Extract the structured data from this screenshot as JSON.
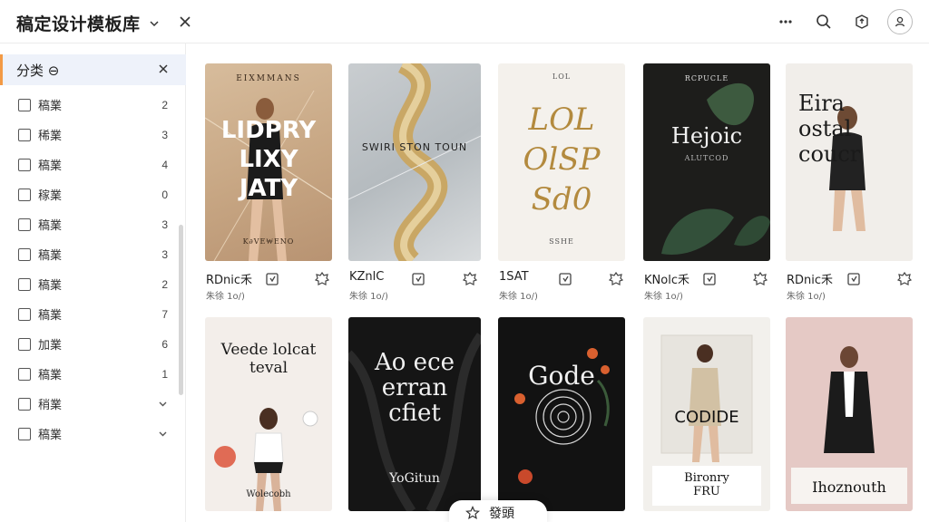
{
  "header": {
    "title": "稿定设计模板库"
  },
  "sidebar": {
    "category_title": "分类 ⊖",
    "items": [
      {
        "label": "稿業",
        "count": "2"
      },
      {
        "label": "稀業",
        "count": "3"
      },
      {
        "label": "稿業",
        "count": "4"
      },
      {
        "label": "稼業",
        "count": "0"
      },
      {
        "label": "稿業",
        "count": "3"
      },
      {
        "label": "稿業",
        "count": "3"
      },
      {
        "label": "稿業",
        "count": "2"
      },
      {
        "label": "稿業",
        "count": "7"
      },
      {
        "label": "加業",
        "count": "6"
      },
      {
        "label": "稿業",
        "count": "1"
      },
      {
        "label": "稍業",
        "count": ""
      },
      {
        "label": "稿業",
        "count": ""
      }
    ]
  },
  "cards": [
    {
      "name": "RDnic禾",
      "sub": "朱徐 1o/)",
      "poster_top": "EIXMMANS",
      "poster_main": "LIDPRY LIXY JATY",
      "poster_bottom": "K∂VE₩ENO"
    },
    {
      "name": "KZnlC",
      "sub": "朱徐 1o/)",
      "poster_top": "SWIRI STON TOUN",
      "poster_main": "",
      "poster_bottom": ""
    },
    {
      "name": "1SAT",
      "sub": "朱徐 1o/)",
      "poster_top": "LOL",
      "poster_main": "LOL OlSP Sd0",
      "poster_bottom": "SSHE"
    },
    {
      "name": "KNolc禾",
      "sub": "朱徐 1o/)",
      "poster_top": "RCPUCLE",
      "poster_main": "Hejoic",
      "poster_bottom": "ALUTCOD"
    },
    {
      "name": "RDnic禾",
      "sub": "朱徐 1o/)",
      "poster_top": "",
      "poster_main": "Eira ostal coucr",
      "poster_bottom": ""
    },
    {
      "name": "",
      "sub": "",
      "poster_top": "",
      "poster_main": "Veede lolcat teval",
      "poster_bottom": "Wolecobh"
    },
    {
      "name": "",
      "sub": "",
      "poster_top": "",
      "poster_main": "Ao ece erran cfiet",
      "poster_bottom": "YoGitun"
    },
    {
      "name": "",
      "sub": "",
      "poster_top": "",
      "poster_main": "Gode",
      "poster_bottom": ""
    },
    {
      "name": "",
      "sub": "",
      "poster_top": "",
      "poster_main": "CODIDE",
      "poster_bottom": "Bironry FRU"
    },
    {
      "name": "",
      "sub": "",
      "poster_top": "",
      "poster_main": "",
      "poster_bottom": "Ihoznouth"
    }
  ],
  "floating_bar": {
    "label": "發頭"
  },
  "colors": {
    "accent": "#f39a45",
    "selected_bg": "#eef2fa"
  }
}
